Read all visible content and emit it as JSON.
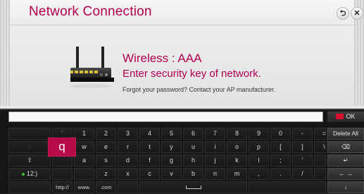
{
  "dialog": {
    "title": "Network Connection",
    "back_icon": "back-arrow-icon",
    "close_icon": "close-icon",
    "network_line": "Wireless : AAA",
    "prompt": "Enter security key of network.",
    "hint": "Forgot your password? Contact your AP manufacturer."
  },
  "keyboard": {
    "input_value": "",
    "ok_label": "OK",
    "row1": [
      "`",
      "1",
      "2",
      "3",
      "4",
      "5",
      "6",
      "7",
      "8",
      "9",
      "0",
      "-",
      "="
    ],
    "row2": [
      "q",
      "w",
      "e",
      "r",
      "t",
      "y",
      "u",
      "i",
      "o",
      "p",
      "[",
      "]",
      "\\"
    ],
    "row3": [
      "a",
      "s",
      "d",
      "f",
      "g",
      "h",
      "j",
      "k",
      "l",
      ";",
      "'"
    ],
    "row4": [
      "z",
      "x",
      "c",
      "v",
      "b",
      "n",
      "m",
      ",",
      ".",
      "/"
    ],
    "shift_label": "⇧",
    "mode_label": "12:)",
    "shortcut_http": "http://",
    "shortcut_www": "www.",
    "shortcut_com": ".com",
    "delete_all_label": "Delete All",
    "backspace_label": "⌫",
    "enter_label": "↵",
    "arrows_label": "←  →",
    "down_label": "↓"
  },
  "colors": {
    "accent": "#b0004e",
    "focus_key": "#b50a47",
    "ok_icon": "#d8112e",
    "keyboard_bg": "#151515"
  }
}
